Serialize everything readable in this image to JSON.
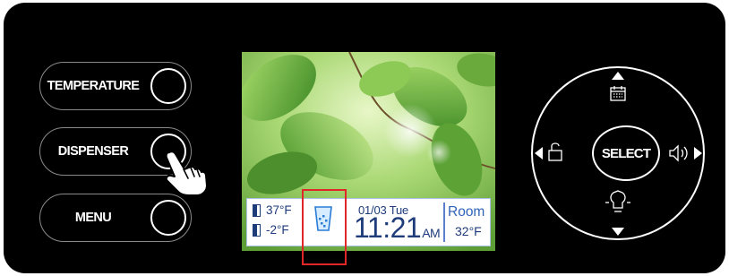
{
  "left_buttons": [
    {
      "label": "TEMPERATURE"
    },
    {
      "label": "DISPENSER"
    },
    {
      "label": "MENU"
    }
  ],
  "display": {
    "fridge_temp": "37°F",
    "freezer_temp": "-2°F",
    "date": "01/03  Tue",
    "time": "11:21",
    "ampm": "AM",
    "room_label": "Room",
    "room_temp": "32°F"
  },
  "dial": {
    "center_label": "SELECT",
    "up_icon": "calendar-icon",
    "left_icon": "lock-icon",
    "right_icon": "sound-icon",
    "down_icon": "light-bulb-icon"
  },
  "colors": {
    "panel": "#000000",
    "status_text": "#1e3b7a",
    "room_text": "#2f63b9",
    "highlight": "#e02626"
  }
}
